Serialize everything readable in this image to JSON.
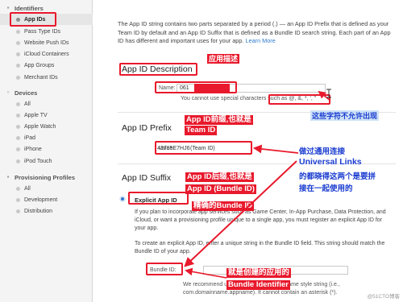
{
  "sidebar": {
    "identifiers_header": "Identifiers",
    "identifiers": [
      "App IDs",
      "Pass Type IDs",
      "Website Push IDs",
      "iCloud Containers",
      "App Groups",
      "Merchant IDs"
    ],
    "devices_header": "Devices",
    "devices": [
      "All",
      "Apple TV",
      "Apple Watch",
      "iPad",
      "iPhone",
      "iPod Touch"
    ],
    "profiles_header": "Provisioning Profiles",
    "profiles": [
      "All",
      "Development",
      "Distribution"
    ]
  },
  "intro": {
    "text": "The App ID string contains two parts separated by a period (.) — an App ID Prefix that is defined as your Team ID by default and an App ID Suffix that is defined as a Bundle ID search string. Each part of an App ID has different and important uses for your app.",
    "link": "Learn More"
  },
  "description": {
    "title": "App ID Description",
    "name_label": "Name:",
    "name_value": "061",
    "note": "You cannot use special characters such as @, &, *, ', \""
  },
  "prefix": {
    "title": "App ID Prefix",
    "value_label": "Value:",
    "value": "43785E7HJ6",
    "tag": "(Team ID)"
  },
  "suffix": {
    "title": "App ID Suffix",
    "radio_label": "Explicit App ID",
    "para1": "If you plan to incorporate app services such as Game Center, In-App Purchase, Data Protection, and iCloud, or want a provisioning profile unique to a single app, you must register an explicit App ID for your app.",
    "para2": "To create an explicit App ID, enter a unique string in the Bundle ID field. This string should match the Bundle ID of your app.",
    "bundle_label": "Bundle ID:",
    "bundle_note1": "We recommend using a reverse-domain name style string (i.e.,",
    "bundle_note2": "com.domainname.appname). It cannot contain an asterisk (*)."
  },
  "annotations": {
    "app_desc": "应用描述",
    "no_special": "这些字符不允许出现",
    "prefix_note1": "App ID前缀,也就是",
    "prefix_note2": "Team ID",
    "suffix_note1": "App ID后缀,也就是",
    "suffix_note2": "App ID (Bundle ID)",
    "precise_note": "精确的Bundle ID",
    "universal1": "做过通用连接",
    "universal2": "Universal Links",
    "universal3": "的都晓得这两个是要拼",
    "universal4": "接在一起使用的",
    "bundle_note1": "就是创建的应用的",
    "bundle_note2": "Bundle Identifier"
  },
  "watermark": "@51CTO博客",
  "colors": {
    "annotation_red": "#e8192c",
    "annotation_blue": "#1a3cd0",
    "link_blue": "#2f7ad1"
  }
}
